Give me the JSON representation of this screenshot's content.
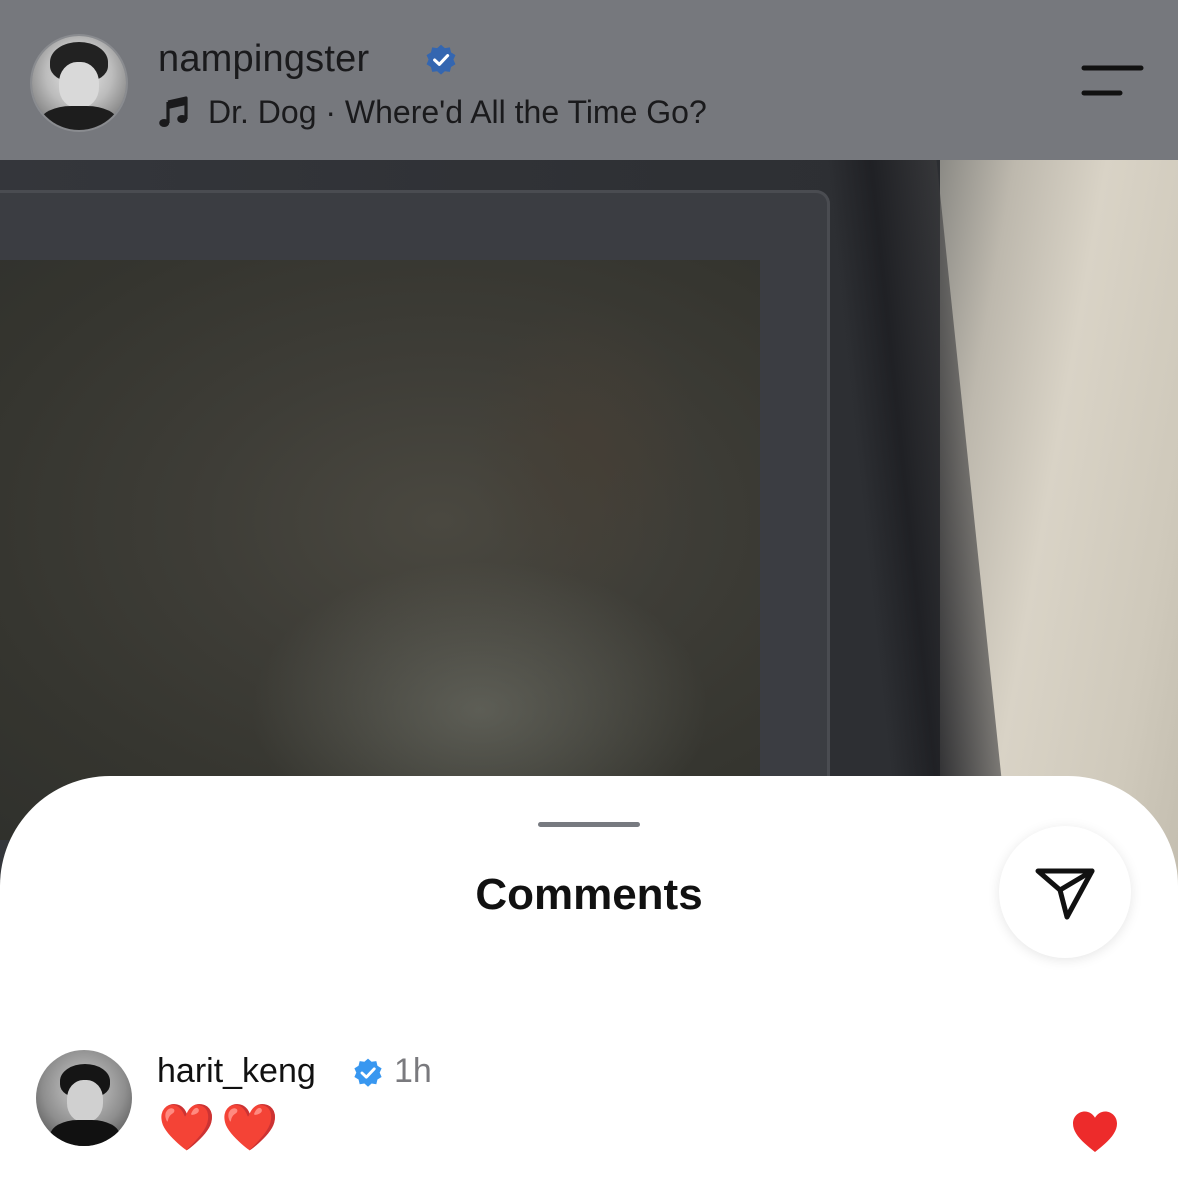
{
  "story": {
    "username": "nampingster",
    "music": {
      "artist": "Dr. Dog",
      "separator": "·",
      "song": "Where'd All the Time Go?",
      "line": "Dr. Dog · Where'd All the Time Go?"
    },
    "icons": {
      "verified": "verified-badge-icon",
      "music": "music-note-icon",
      "menu": "menu-icon"
    }
  },
  "comments_sheet": {
    "title": "Comments",
    "share_icon": "send-icon",
    "items": [
      {
        "username": "harit_keng",
        "verified": true,
        "time": "1h",
        "text": "❤️❤️",
        "liked": true
      }
    ]
  },
  "colors": {
    "header_bg": "#76787d",
    "verified_blue": "#3897f0",
    "like_red": "#ed2b2b",
    "sheet_bg": "#ffffff"
  }
}
